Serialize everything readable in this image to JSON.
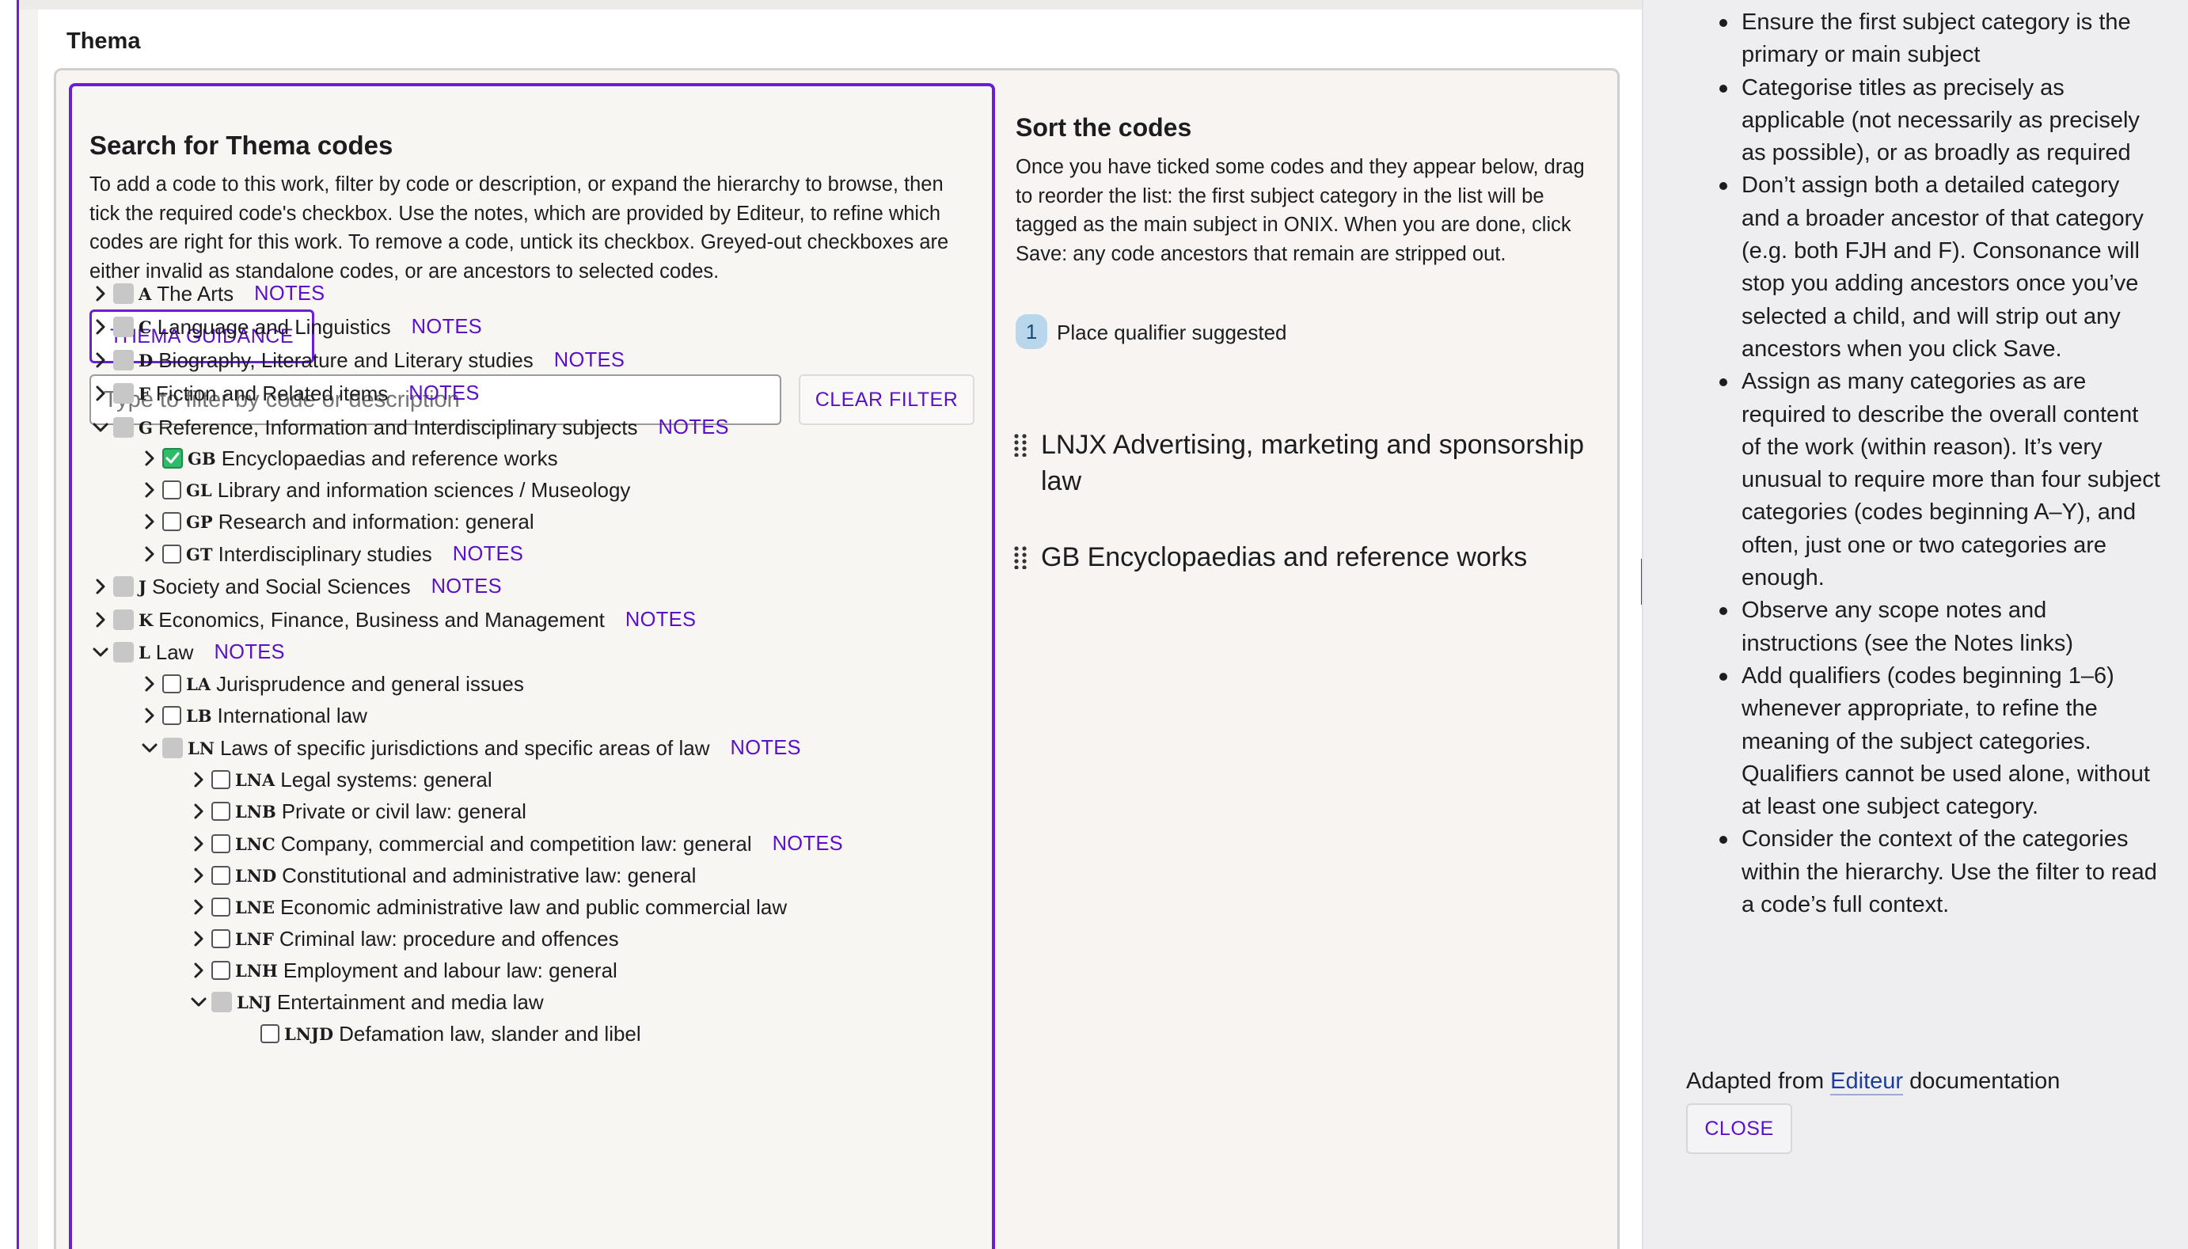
{
  "thema_panel": {
    "title": "Thema"
  },
  "search": {
    "title": "Search for Thema codes",
    "description": "To add a code to this work, filter by code or description, or expand the hierarchy to browse, then tick the required code's checkbox. Use the notes, which are provided by Editeur, to refine which codes are right for this work. To remove a code, untick its checkbox. Greyed-out checkboxes are either invalid as standalone codes, or are ancestors to selected codes.",
    "guidance_button": "THEMA GUIDANCE",
    "filter_placeholder": "Type to filter by code or description",
    "filter_value": "",
    "clear_button": "CLEAR FILTER",
    "notes_label": "NOTES"
  },
  "tree": [
    {
      "code": "A",
      "label": "The Arts",
      "level": 0,
      "expanded": false,
      "box": "grey",
      "notes": true
    },
    {
      "code": "C",
      "label": "Language and Linguistics",
      "level": 0,
      "expanded": false,
      "box": "grey",
      "notes": true
    },
    {
      "code": "D",
      "label": "Biography, Literature and Literary studies",
      "level": 0,
      "expanded": false,
      "box": "grey",
      "notes": true
    },
    {
      "code": "F",
      "label": "Fiction and Related items",
      "level": 0,
      "expanded": false,
      "box": "grey",
      "notes": true
    },
    {
      "code": "G",
      "label": "Reference, Information and Interdisciplinary subjects",
      "level": 0,
      "expanded": true,
      "box": "grey",
      "notes": true
    },
    {
      "code": "GB",
      "label": "Encyclopaedias and reference works",
      "level": 1,
      "expanded": false,
      "box": "checked",
      "notes": false
    },
    {
      "code": "GL",
      "label": "Library and information sciences / Museology",
      "level": 1,
      "expanded": false,
      "box": "empty",
      "notes": false
    },
    {
      "code": "GP",
      "label": "Research and information: general",
      "level": 1,
      "expanded": false,
      "box": "empty",
      "notes": false
    },
    {
      "code": "GT",
      "label": "Interdisciplinary studies",
      "level": 1,
      "expanded": false,
      "box": "empty",
      "notes": true
    },
    {
      "code": "J",
      "label": "Society and Social Sciences",
      "level": 0,
      "expanded": false,
      "box": "grey",
      "notes": true
    },
    {
      "code": "K",
      "label": "Economics, Finance, Business and Management",
      "level": 0,
      "expanded": false,
      "box": "grey",
      "notes": true
    },
    {
      "code": "L",
      "label": "Law",
      "level": 0,
      "expanded": true,
      "box": "grey",
      "notes": true
    },
    {
      "code": "LA",
      "label": "Jurisprudence and general issues",
      "level": 1,
      "expanded": false,
      "box": "empty",
      "notes": false
    },
    {
      "code": "LB",
      "label": "International law",
      "level": 1,
      "expanded": false,
      "box": "empty",
      "notes": false
    },
    {
      "code": "LN",
      "label": "Laws of specific jurisdictions and specific areas of law",
      "level": 1,
      "expanded": true,
      "box": "grey",
      "notes": true
    },
    {
      "code": "LNA",
      "label": "Legal systems: general",
      "level": 2,
      "expanded": false,
      "box": "empty",
      "notes": false
    },
    {
      "code": "LNB",
      "label": "Private or civil law: general",
      "level": 2,
      "expanded": false,
      "box": "empty",
      "notes": false
    },
    {
      "code": "LNC",
      "label": "Company, commercial and competition law: general",
      "level": 2,
      "expanded": false,
      "box": "empty",
      "notes": true
    },
    {
      "code": "LND",
      "label": "Constitutional and administrative law: general",
      "level": 2,
      "expanded": false,
      "box": "empty",
      "notes": false
    },
    {
      "code": "LNE",
      "label": "Economic administrative law and public commercial law",
      "level": 2,
      "expanded": false,
      "box": "empty",
      "notes": false
    },
    {
      "code": "LNF",
      "label": "Criminal law: procedure and offences",
      "level": 2,
      "expanded": false,
      "box": "empty",
      "notes": false
    },
    {
      "code": "LNH",
      "label": "Employment and labour law: general",
      "level": 2,
      "expanded": false,
      "box": "empty",
      "notes": false
    },
    {
      "code": "LNJ",
      "label": "Entertainment and media law",
      "level": 2,
      "expanded": true,
      "box": "grey",
      "notes": false
    },
    {
      "code": "LNJD",
      "label": "Defamation law, slander and libel",
      "level": 3,
      "expanded": null,
      "box": "empty",
      "notes": false
    }
  ],
  "sort": {
    "title": "Sort the codes",
    "description": "Once you have ticked some codes and they appear below, drag to reorder the list: the first subject category in the list will be tagged as the main subject in ONIX. When you are done, click Save: any code ancestors that remain are stripped out.",
    "qualifier_count": "1",
    "qualifier_text": "Place qualifier suggested",
    "items": [
      "LNJX Advertising, marketing and sponsorship law",
      "GB Encyclopaedias and reference works"
    ]
  },
  "guidance": {
    "items": [
      "Ensure the first subject category is the primary or main subject",
      "Categorise titles as precisely as applicable (not necessarily as precisely as possible), or as broadly as required",
      "Don’t assign both a detailed category and a broader ancestor of that category (e.g. both FJH and F). Consonance will stop you adding ancestors once you’ve selected a child, and will strip out any ancestors when you click Save.",
      "Assign as many categories as are required to describe the overall content of the work (within reason). It’s very unusual to require more than four subject categories (codes beginning A–Y), and often, just one or two categories are enough.",
      "Observe any scope notes and instructions (see the Notes links)",
      "Add qualifiers (codes beginning 1–6) whenever appropriate, to refine the meaning of the subject categories. Qualifiers cannot be used alone, without at least one subject category.",
      "Consider the context of the categories within the hierarchy. Use the filter to read a code’s full context."
    ],
    "adapted_prefix": "Adapted from ",
    "adapted_link": "Editeur",
    "adapted_suffix": " documentation",
    "close_button": "CLOSE"
  },
  "colors": {
    "accent": "#6a1ed6",
    "link": "#5b0fc9",
    "checked": "#2ebc6a",
    "badge": "#b8d6ec"
  }
}
